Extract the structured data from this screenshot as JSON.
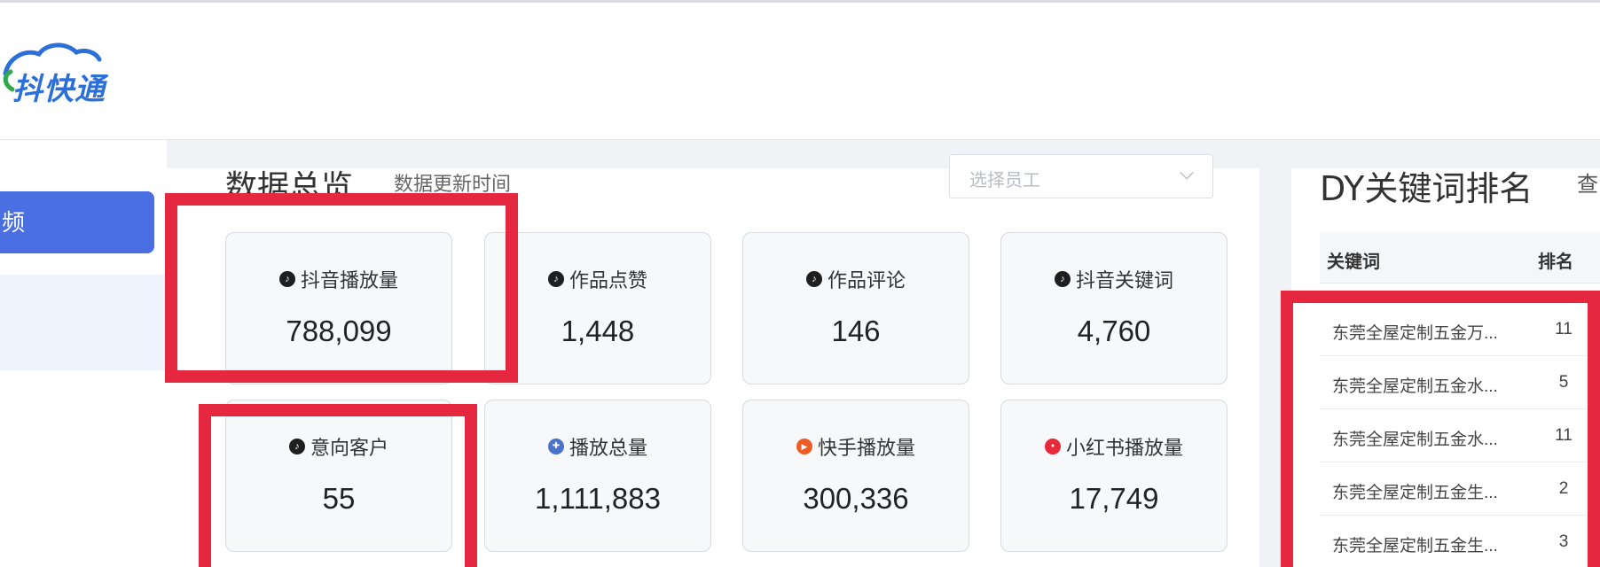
{
  "app": {
    "logo_text": "抖快通"
  },
  "sidebar": {
    "active_item": "频"
  },
  "overview": {
    "title": "数据总览",
    "update_label": "数据更新时间",
    "employee_placeholder": "选择员工"
  },
  "cards": [
    {
      "label": "抖音播放量",
      "value": "788,099",
      "icon": "douyin-icon"
    },
    {
      "label": "作品点赞",
      "value": "1,448",
      "icon": "douyin-icon"
    },
    {
      "label": "作品评论",
      "value": "146",
      "icon": "douyin-icon"
    },
    {
      "label": "抖音关键词",
      "value": "4,760",
      "icon": "douyin-icon"
    },
    {
      "label": "意向客户",
      "value": "55",
      "icon": "douyin-icon"
    },
    {
      "label": "播放总量",
      "value": "1,111,883",
      "icon": "play-total-icon"
    },
    {
      "label": "快手播放量",
      "value": "300,336",
      "icon": "kuaishou-icon"
    },
    {
      "label": "小红书播放量",
      "value": "17,749",
      "icon": "xiaohongshu-icon"
    }
  ],
  "ranking": {
    "title": "DY关键词排名",
    "more_label": "查",
    "col_keyword": "关键词",
    "col_rank": "排名",
    "rows": [
      {
        "keyword": "东莞全屋定制五金万...",
        "rank": "11"
      },
      {
        "keyword": "东莞全屋定制五金水...",
        "rank": "5"
      },
      {
        "keyword": "东莞全屋定制五金水...",
        "rank": "11"
      },
      {
        "keyword": "东莞全屋定制五金生...",
        "rank": "2"
      },
      {
        "keyword": "东莞全屋定制五金生...",
        "rank": "3"
      }
    ]
  },
  "colors": {
    "accent": "#4a6fe3",
    "highlight": "#e5283f",
    "brand_logo": "#2b6fd8"
  }
}
